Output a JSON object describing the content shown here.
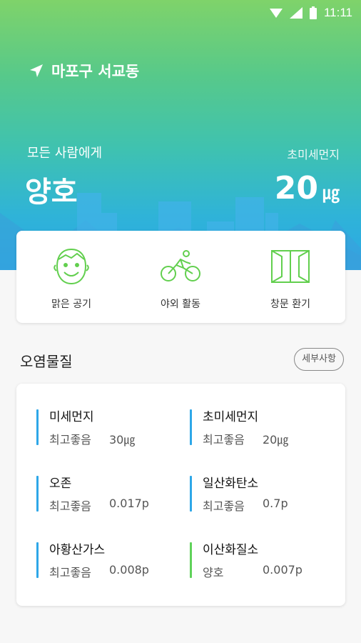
{
  "status": {
    "time": "11:11"
  },
  "location": {
    "name": "마포구 서교동"
  },
  "summary": {
    "message_sub": "모든 사람에게",
    "message_main": "양호",
    "pm_label": "초미세먼지",
    "pm_value": "20",
    "pm_unit": "㎍"
  },
  "activities": [
    {
      "label": "맑은 공기",
      "icon": "smiling-face-icon"
    },
    {
      "label": "야외 활동",
      "icon": "bicycle-icon"
    },
    {
      "label": "창문 환기",
      "icon": "window-icon"
    }
  ],
  "pollutants_section": {
    "title": "오염물질",
    "detail_button": "세부사항"
  },
  "pollutants": [
    {
      "name": "미세먼지",
      "grade": "최고좋음",
      "value": "30㎍",
      "color": "#2ea7e8"
    },
    {
      "name": "초미세먼지",
      "grade": "최고좋음",
      "value": "20㎍",
      "color": "#2ea7e8"
    },
    {
      "name": "오존",
      "grade": "최고좋음",
      "value": "0.017p",
      "color": "#2ea7e8"
    },
    {
      "name": "일산화탄소",
      "grade": "최고좋음",
      "value": "0.7p",
      "color": "#2ea7e8"
    },
    {
      "name": "아황산가스",
      "grade": "최고좋음",
      "value": "0.008p",
      "color": "#2ea7e8"
    },
    {
      "name": "이산화질소",
      "grade": "양호",
      "value": "0.007p",
      "color": "#5fd25a"
    }
  ],
  "colors": {
    "good": "#2ea7e8",
    "moderate": "#5fd25a",
    "icon_green": "#62cf4e"
  }
}
